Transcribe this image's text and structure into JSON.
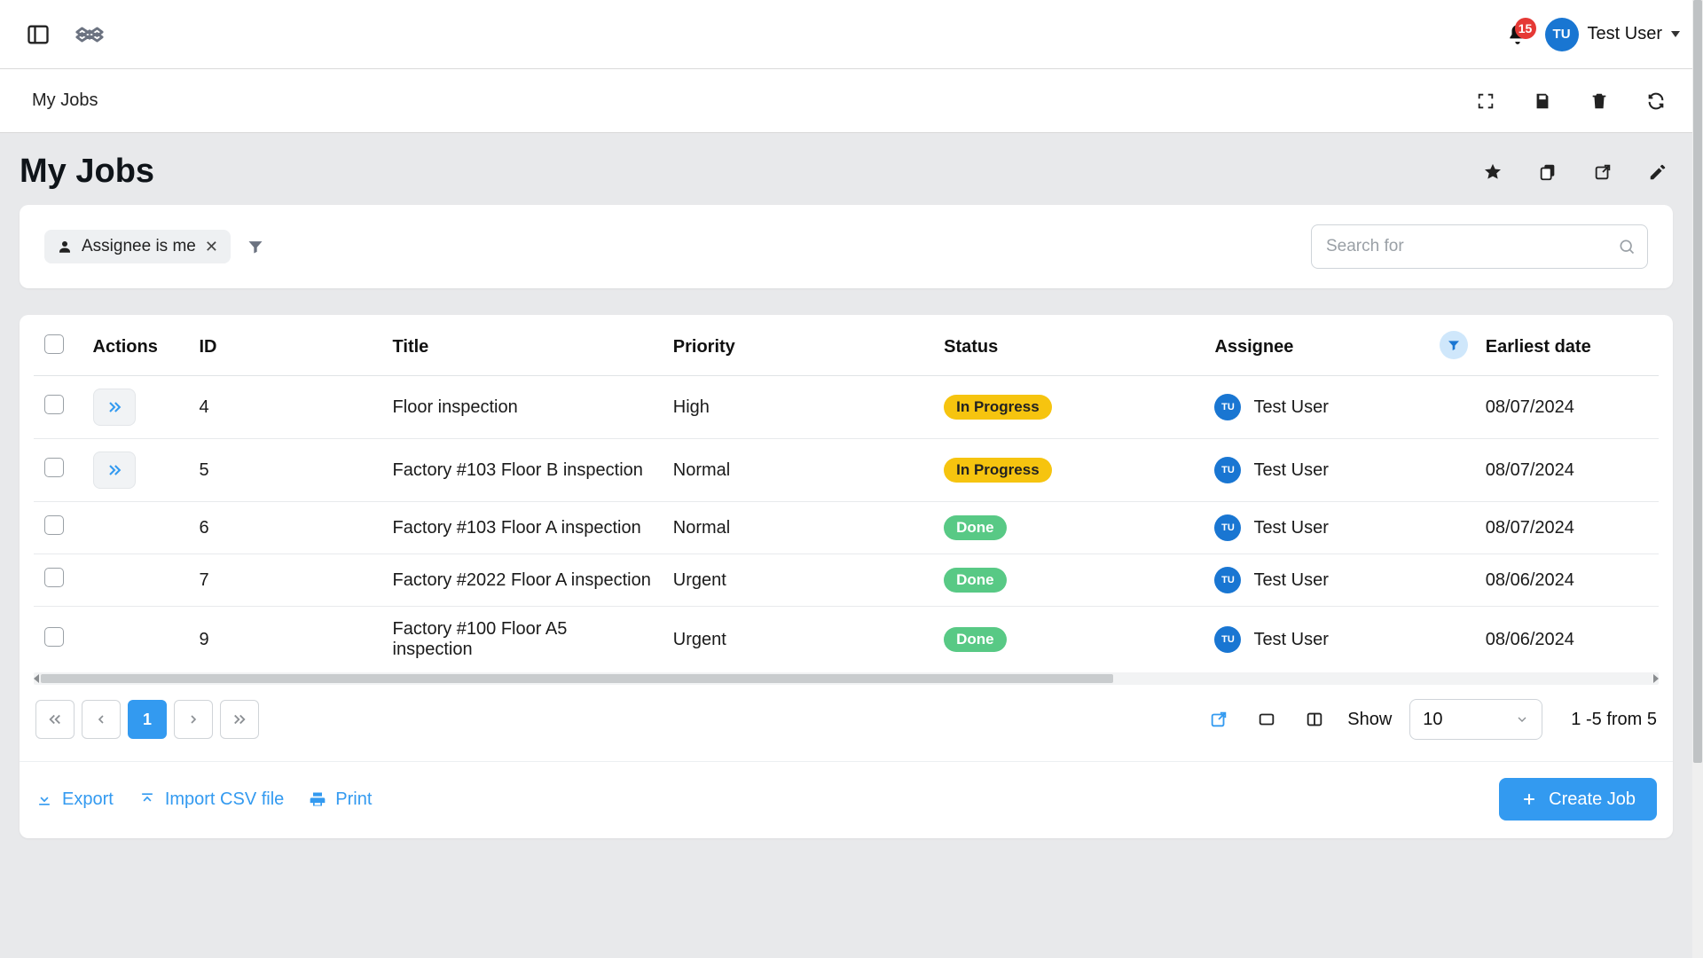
{
  "topbar": {
    "notifications_count": "15",
    "user_initials": "TU",
    "user_name": "Test User"
  },
  "viewbar": {
    "title": "My Jobs"
  },
  "page": {
    "heading": "My Jobs"
  },
  "filters": {
    "chip_label": "Assignee is me",
    "search_placeholder": "Search for"
  },
  "table": {
    "headers": {
      "actions": "Actions",
      "id": "ID",
      "title": "Title",
      "priority": "Priority",
      "status": "Status",
      "assignee": "Assignee",
      "date": "Earliest date"
    },
    "rows": [
      {
        "id": "4",
        "title": "Floor inspection",
        "priority": "High",
        "status": "In Progress",
        "status_class": "inprogress",
        "assignee_initials": "TU",
        "assignee_name": "Test User",
        "date": "08/07/2024",
        "has_action": true
      },
      {
        "id": "5",
        "title": "Factory #103 Floor B inspection",
        "priority": "Normal",
        "status": "In Progress",
        "status_class": "inprogress",
        "assignee_initials": "TU",
        "assignee_name": "Test User",
        "date": "08/07/2024",
        "has_action": true
      },
      {
        "id": "6",
        "title": "Factory #103 Floor A inspection",
        "priority": "Normal",
        "status": "Done",
        "status_class": "done",
        "assignee_initials": "TU",
        "assignee_name": "Test User",
        "date": "08/07/2024",
        "has_action": false
      },
      {
        "id": "7",
        "title": "Factory #2022 Floor A inspection",
        "priority": "Urgent",
        "status": "Done",
        "status_class": "done",
        "assignee_initials": "TU",
        "assignee_name": "Test User",
        "date": "08/06/2024",
        "has_action": false
      },
      {
        "id": "9",
        "title": "Factory #100 Floor A5 inspection",
        "priority": "Urgent",
        "status": "Done",
        "status_class": "done",
        "assignee_initials": "TU",
        "assignee_name": "Test User",
        "date": "08/06/2024",
        "has_action": false
      }
    ]
  },
  "pager": {
    "current": "1",
    "show_label": "Show",
    "page_size": "10",
    "range_label": "1 -5 from 5"
  },
  "footer": {
    "export": "Export",
    "import": "Import CSV file",
    "print": "Print",
    "create": "Create Job"
  }
}
